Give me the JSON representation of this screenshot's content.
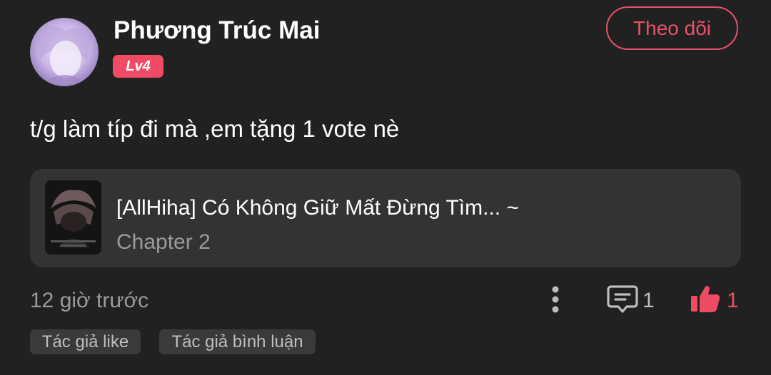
{
  "user": {
    "name": "Phương Trúc Mai",
    "level": "Lv4"
  },
  "follow_button": {
    "label": "Theo dõi"
  },
  "comment": {
    "text": "t/g làm típ đi mà ,em tặng 1 vote nè",
    "time": "12 giờ trước"
  },
  "story": {
    "title": "[AllHiha] Có Không Giữ Mất Đừng Tìm... ~",
    "chapter": "Chapter 2"
  },
  "actions": {
    "more_icon": "more-vertical-icon",
    "comment_icon": "comment-icon",
    "comment_count": "1",
    "like_icon": "thumbs-up-icon",
    "like_count": "1"
  },
  "tags": [
    {
      "label": "Tác giả like"
    },
    {
      "label": "Tác giả bình luận"
    }
  ],
  "colors": {
    "accent": "#f04b64",
    "background": "#212121",
    "card": "#333333"
  }
}
